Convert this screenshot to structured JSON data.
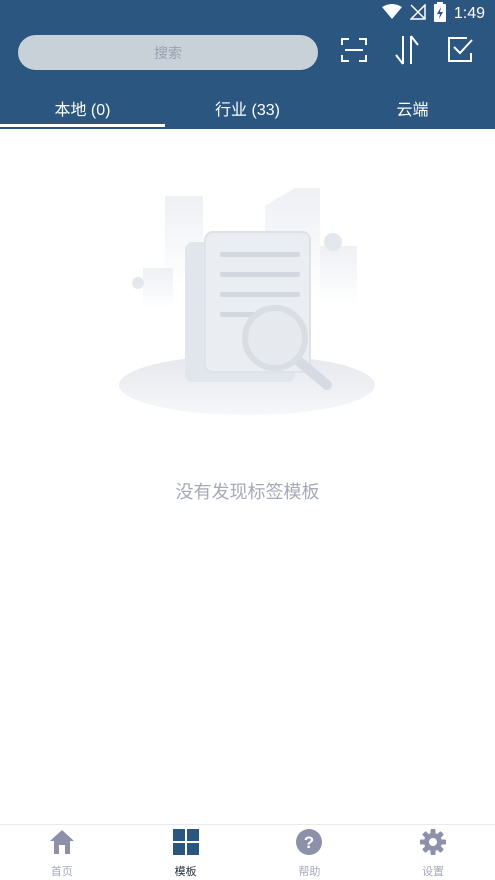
{
  "status_bar": {
    "time": "1:49",
    "icons": [
      "wifi-icon",
      "signal-icon",
      "battery-icon"
    ]
  },
  "search": {
    "placeholder": "搜索"
  },
  "toolbar": {
    "actions": [
      "scan-icon",
      "sort-icon",
      "select-icon"
    ]
  },
  "tabs": [
    {
      "label": "本地 (0)",
      "active": true
    },
    {
      "label": "行业 (33)",
      "active": false
    },
    {
      "label": "云端",
      "active": false
    }
  ],
  "empty_state": {
    "message": "没有发现标签模板"
  },
  "bottom_nav": [
    {
      "label": "首页",
      "icon": "home-icon",
      "active": false
    },
    {
      "label": "模板",
      "icon": "grid-icon",
      "active": true
    },
    {
      "label": "帮助",
      "icon": "help-icon",
      "active": false
    },
    {
      "label": "设置",
      "icon": "gear-icon",
      "active": false
    }
  ],
  "colors": {
    "header": "#2a5680",
    "accent_active": "#2a5680",
    "inactive": "#a6aab8"
  }
}
